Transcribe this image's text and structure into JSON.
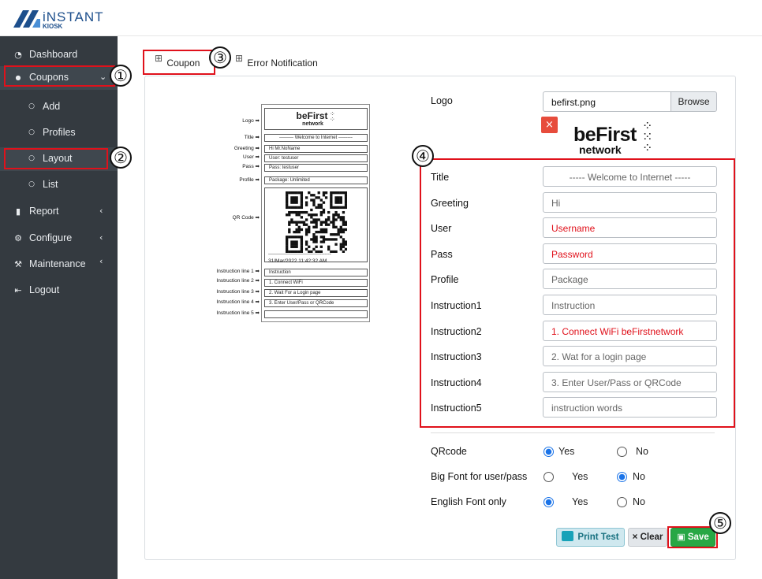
{
  "brand": {
    "name": "iNSTANT",
    "sub": "KIOSK"
  },
  "sidebar": {
    "items": [
      {
        "icon": "dashboard-icon",
        "glyph": "◔",
        "label": "Dashboard"
      },
      {
        "icon": "tag-icon",
        "glyph": "●",
        "label": "Coupons",
        "arrow": "⌄"
      },
      {
        "icon": "circle-icon",
        "glyph": "○",
        "label": "Add"
      },
      {
        "icon": "circle-icon",
        "glyph": "○",
        "label": "Profiles"
      },
      {
        "icon": "circle-icon",
        "glyph": "○",
        "label": "Layout"
      },
      {
        "icon": "circle-icon",
        "glyph": "○",
        "label": "List"
      },
      {
        "icon": "chart-icon",
        "glyph": "▮",
        "label": "Report",
        "arrow": "‹"
      },
      {
        "icon": "gear-icon",
        "glyph": "⚙",
        "label": "Configure",
        "arrow": "‹"
      },
      {
        "icon": "wrench-icon",
        "glyph": "⚒",
        "label": "Maintenance",
        "arrow": "‹"
      },
      {
        "icon": "logout-icon",
        "glyph": "⇤",
        "label": "Logout"
      }
    ]
  },
  "tabs": [
    {
      "icon": "grid-icon",
      "glyph": "⊞",
      "label": "Coupon"
    },
    {
      "icon": "grid-icon",
      "glyph": "⊞",
      "label": "Error Notification"
    }
  ],
  "markers": [
    "①",
    "②",
    "③",
    "④",
    "⑤"
  ],
  "preview": {
    "labels": {
      "logo": "Logo ➡",
      "title": "Title ➡",
      "greeting": "Greeting ➡",
      "user": "User ➡",
      "pass": "Pass ➡",
      "profile": "Profile ➡",
      "qr": "QR Code ➡",
      "i1": "Instruction line 1 ➡",
      "i2": "Instruction line 2 ➡",
      "i3": "Instruction line 3 ➡",
      "i4": "Instruction line 4 ➡",
      "i5": "Instruction line 5 ➡"
    },
    "logo_text": "beFirst",
    "logo_sub": "network",
    "title": "--------- Welcome to Internet ---------",
    "greeting": "Hi Mr.NoName",
    "user": "User: testuser",
    "pass": "Pass: testuser",
    "profile": "Package: Unlimited",
    "dashes": "----------------------------------------",
    "date": "31/Mar/2022 11:42:32 AM",
    "i1": "Instruction",
    "i2": "1. Connect WiFi",
    "i3": "2. Wait For a Login page",
    "i4": "3. Enter User/Pass or QRCode",
    "i5": ""
  },
  "form": {
    "logo_label": "Logo",
    "logo_file": "befirst.png",
    "browse": "Browse",
    "remove": "×",
    "logo_text": "beFirst",
    "logo_sub": "network",
    "fields": [
      {
        "label": "Title",
        "value": "----- Welcome to Internet -----",
        "style": "muted"
      },
      {
        "label": "Greeting",
        "value": "Hi",
        "style": "muted"
      },
      {
        "label": "User",
        "value": "Username",
        "style": "red"
      },
      {
        "label": "Pass",
        "value": "Password",
        "style": "red"
      },
      {
        "label": "Profile",
        "value": "Package",
        "style": "muted"
      },
      {
        "label": "Instruction1",
        "value": "Instruction",
        "style": "muted"
      },
      {
        "label": "Instruction2",
        "value": "1. Connect WiFi beFirstnetwork",
        "style": "red"
      },
      {
        "label": "Instruction3",
        "value": "2. Wat for a login page",
        "style": "muted"
      },
      {
        "label": "Instruction4",
        "value": "3. Enter User/Pass or QRCode",
        "style": "muted"
      },
      {
        "label": "Instruction5",
        "value": "instruction words",
        "style": "muted"
      }
    ],
    "options": [
      {
        "label": "QRcode",
        "yes": "Yes",
        "no": "No",
        "selected": "yes"
      },
      {
        "label": "Big Font for user/pass",
        "yes": "Yes",
        "no": "No",
        "selected": "no"
      },
      {
        "label": "English Font only",
        "yes": "Yes",
        "no": "No",
        "selected": "yes"
      }
    ]
  },
  "buttons": {
    "print": "Print Test",
    "clear": "× Clear",
    "save": "Save"
  },
  "colors": {
    "sidebar": "#343a40",
    "highlight": "#e0111b",
    "save": "#28a745",
    "print": "#17a2b8"
  }
}
